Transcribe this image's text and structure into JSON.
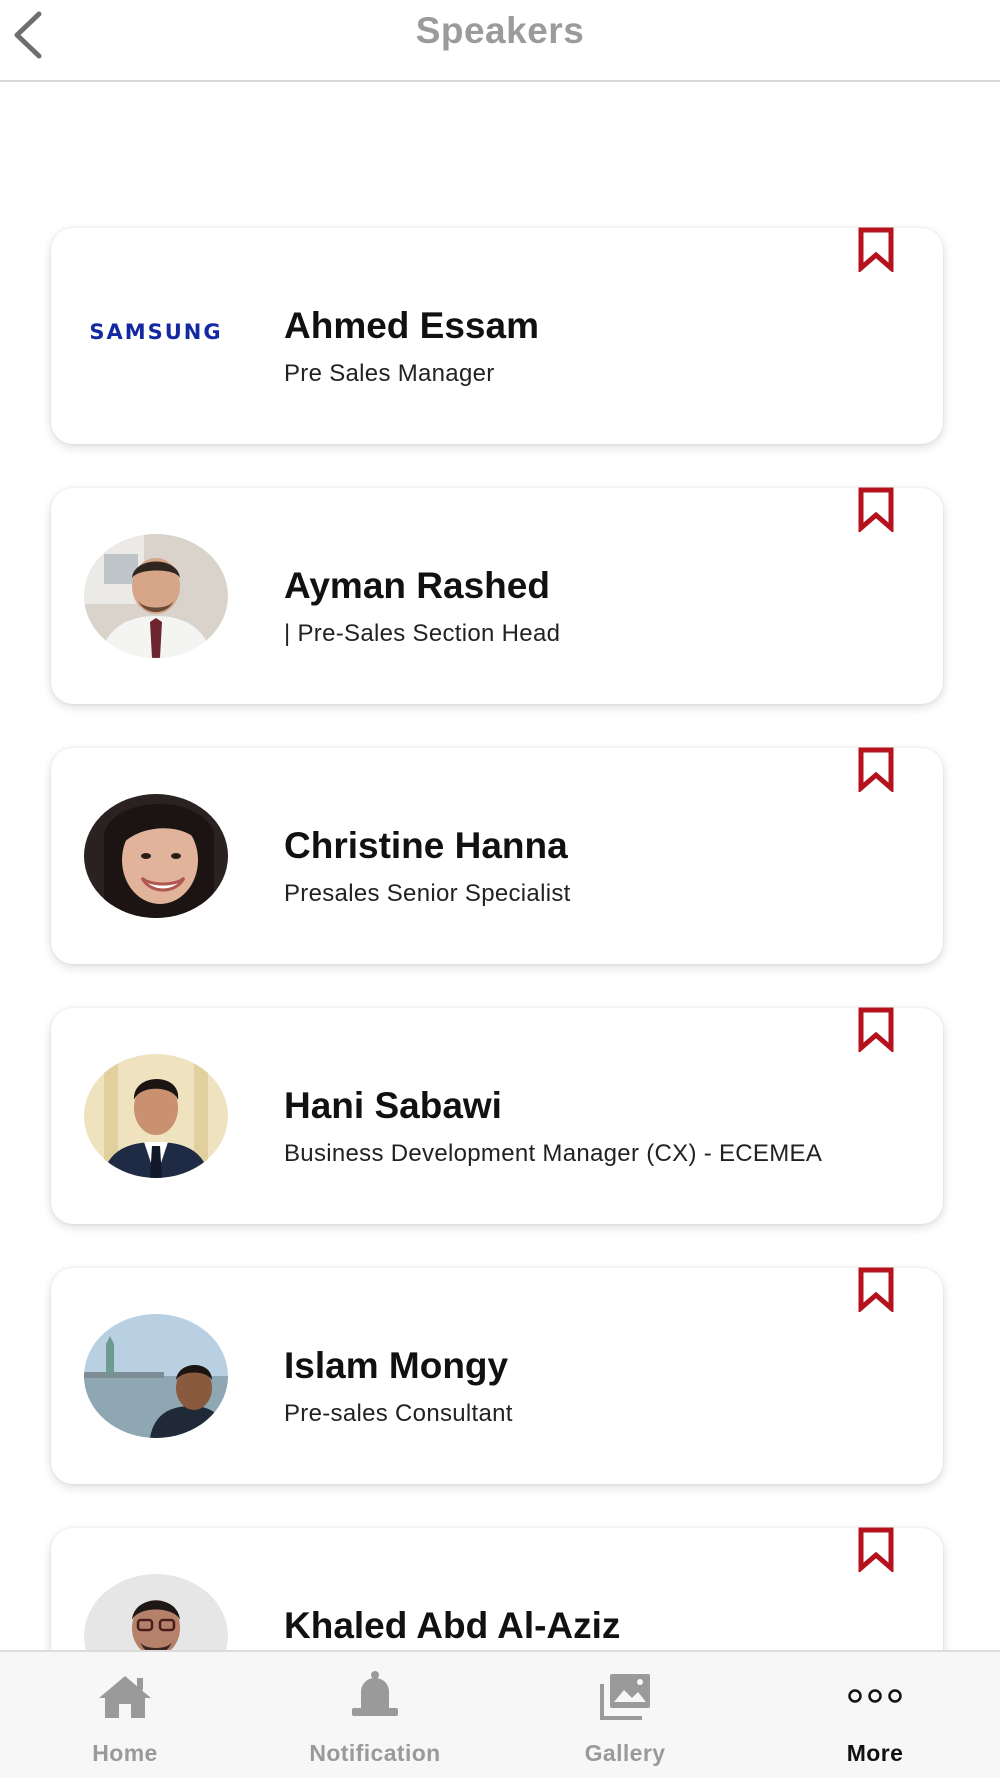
{
  "header": {
    "title": "Speakers",
    "back_icon": "chevron-left-icon"
  },
  "speakers": [
    {
      "name": "Ahmed Essam",
      "role": "Pre Sales Manager",
      "image": "samsung-logo",
      "logo_text": "SAMSUNG"
    },
    {
      "name": "Ayman Rashed",
      "role": "| Pre-Sales Section Head",
      "image": "photo"
    },
    {
      "name": "Christine Hanna",
      "role": "Presales Senior Specialist",
      "image": "photo"
    },
    {
      "name": "Hani Sabawi",
      "role": "Business Development Manager (CX) - ECEMEA",
      "image": "photo"
    },
    {
      "name": "Islam Mongy",
      "role": "Pre-sales Consultant",
      "image": "photo"
    },
    {
      "name": "Khaled  Abd Al-Aziz",
      "role": "",
      "image": "photo"
    }
  ],
  "colors": {
    "bookmark": "#b5121b",
    "samsung_blue": "#1428a0",
    "header_title": "#9b9b9b",
    "tab_inactive": "#9a9a9a",
    "tab_active": "#111111"
  },
  "tabbar": {
    "tabs": [
      {
        "label": "Home",
        "icon": "home-icon",
        "active": false
      },
      {
        "label": "Notification",
        "icon": "bell-icon",
        "active": false
      },
      {
        "label": "Gallery",
        "icon": "gallery-icon",
        "active": false
      },
      {
        "label": "More",
        "icon": "more-dots-icon",
        "active": true
      }
    ]
  }
}
